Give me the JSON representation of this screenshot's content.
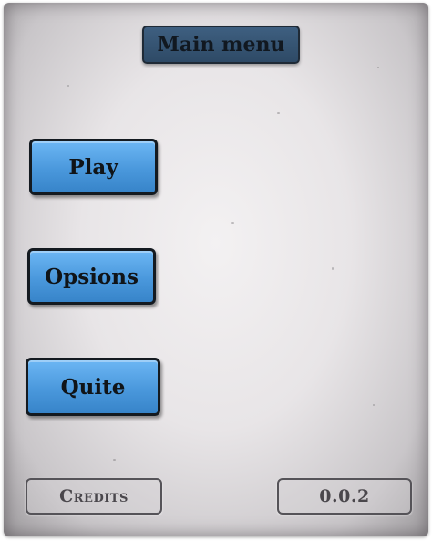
{
  "header": {
    "title": "Main menu"
  },
  "menu": {
    "play_label": "Play",
    "options_label": "Opsions",
    "quit_label": "Quite"
  },
  "footer": {
    "credits_label": "Credits",
    "version": "0.0.2"
  },
  "colors": {
    "button_blue": "#4a98dc",
    "title_box": "#3e5f80",
    "paper_background": "#e8e5e7"
  }
}
